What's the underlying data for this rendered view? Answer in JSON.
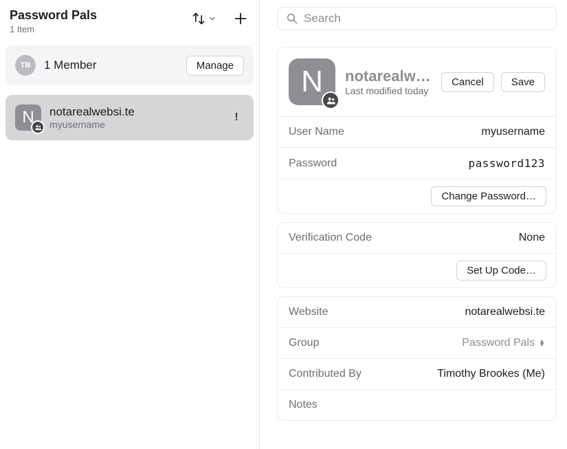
{
  "sidebar": {
    "title": "Password Pals",
    "subtitle": "1 Item",
    "member_card": {
      "avatar_initials": "TB",
      "label": "1 Member",
      "manage_label": "Manage"
    },
    "item": {
      "tile_letter": "N",
      "title": "notarealwebsi.te",
      "subtitle": "myusername",
      "warning_glyph": "!"
    }
  },
  "search": {
    "placeholder": "Search"
  },
  "detail": {
    "tile_letter": "N",
    "title": "notarealwebsi",
    "subtitle": "Last modified today",
    "cancel_label": "Cancel",
    "save_label": "Save",
    "fields": {
      "username_label": "User Name",
      "username_value": "myusername",
      "password_label": "Password",
      "password_value": "password123",
      "change_password_label": "Change Password…",
      "verification_label": "Verification Code",
      "verification_value": "None",
      "setup_code_label": "Set Up Code…",
      "website_label": "Website",
      "website_value": "notarealwebsi.te",
      "group_label": "Group",
      "group_value": "Password Pals",
      "contributed_label": "Contributed By",
      "contributed_value": "Timothy Brookes (Me)",
      "notes_label": "Notes"
    }
  }
}
